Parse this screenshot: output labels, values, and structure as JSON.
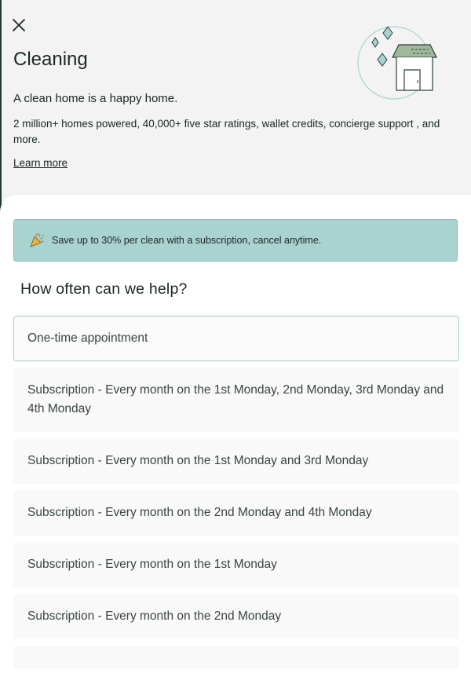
{
  "header": {
    "close_icon": "close-icon",
    "title": "Cleaning",
    "tagline": "A clean home is a happy home.",
    "description": "2 million+ homes powered, 40,000+ five star ratings, wallet credits, concierge support , and more.",
    "learn_more": "Learn more"
  },
  "banner": {
    "icon": "party-popper-icon",
    "text": "Save up to 30% per clean with a subscription, cancel anytime."
  },
  "frequency": {
    "title": "How often can we help?",
    "options": [
      {
        "label": "One-time appointment",
        "selected": true
      },
      {
        "label": "Subscription - Every month on the 1st Monday, 2nd Monday, 3rd Monday and 4th Monday",
        "selected": false
      },
      {
        "label": "Subscription - Every month on the 1st Monday and 3rd Monday",
        "selected": false
      },
      {
        "label": "Subscription - Every month on the 2nd Monday and 4th Monday",
        "selected": false
      },
      {
        "label": "Subscription - Every month on the 1st Monday",
        "selected": false
      },
      {
        "label": "Subscription - Every month on the 2nd Monday",
        "selected": false
      }
    ]
  },
  "colors": {
    "banner_bg": "#a8d3cf",
    "selected_border": "#9fd0c9",
    "page_bg": "#f3f3f3"
  }
}
